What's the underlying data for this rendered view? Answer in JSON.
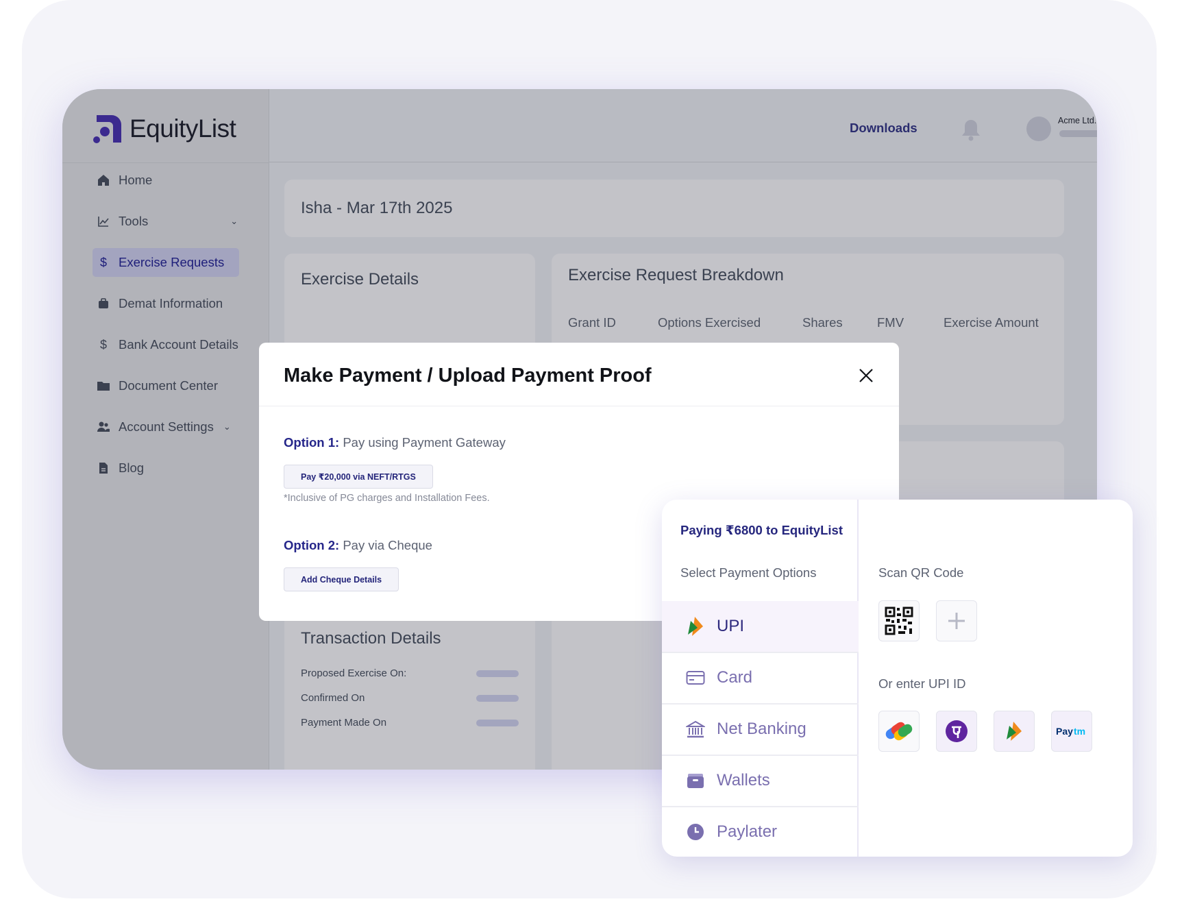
{
  "brand": {
    "name": "EquityList"
  },
  "sidebar": {
    "items": [
      {
        "label": "Home",
        "icon": "home-icon"
      },
      {
        "label": "Tools",
        "icon": "chart-line-icon"
      },
      {
        "label": "Exercise Requests",
        "icon": "dollar-icon"
      },
      {
        "label": "Demat Information",
        "icon": "briefcase-icon"
      },
      {
        "label": "Bank Account Details",
        "icon": "dollar-icon"
      },
      {
        "label": "Document Center",
        "icon": "folder-icon"
      },
      {
        "label": "Account Settings",
        "icon": "users-icon"
      },
      {
        "label": "Blog",
        "icon": "file-icon"
      }
    ]
  },
  "header": {
    "downloads": "Downloads",
    "account_name": "Acme Ltd."
  },
  "page": {
    "title": "Isha - Mar 17th 2025",
    "exercise_details_title": "Exercise Details",
    "breakdown": {
      "title": "Exercise Request Breakdown",
      "columns": [
        "Grant ID",
        "Options Exercised",
        "Shares",
        "FMV",
        "Exercise Amount"
      ]
    },
    "transaction": {
      "title": "Transaction Details",
      "rows": [
        "Proposed Exercise On:",
        "Confirmed On",
        "Payment Made On"
      ]
    }
  },
  "modal": {
    "title": "Make Payment / Upload Payment Proof",
    "option1": {
      "label": "Option 1:",
      "text": " Pay using Payment Gateway",
      "button": "Pay ₹20,000 via NEFT/RTGS",
      "note": "*Inclusive of PG charges and Installation Fees."
    },
    "option2": {
      "label": "Option 2:",
      "text": " Pay via Cheque",
      "button": "Add Cheque Details"
    }
  },
  "payment": {
    "heading": "Paying ₹6800 to EquityList",
    "select_label": "Select Payment Options",
    "options": [
      "UPI",
      "Card",
      "Net Banking",
      "Wallets",
      "Paylater"
    ],
    "scan_label": "Scan QR Code",
    "upi_label": "Or enter UPI ID",
    "apps": [
      {
        "name": "Google Pay",
        "icon": "google-pay-icon"
      },
      {
        "name": "PhonePe",
        "icon": "phonepe-icon"
      },
      {
        "name": "BHIM",
        "icon": "bhim-icon"
      },
      {
        "name": "Paytm",
        "icon": "paytm-icon"
      }
    ],
    "paytm_logo_text": "Paytm"
  },
  "colors": {
    "accent": "#25268a",
    "overlay": "#b9bbc2",
    "selected_bg": "#f7f3fc"
  }
}
